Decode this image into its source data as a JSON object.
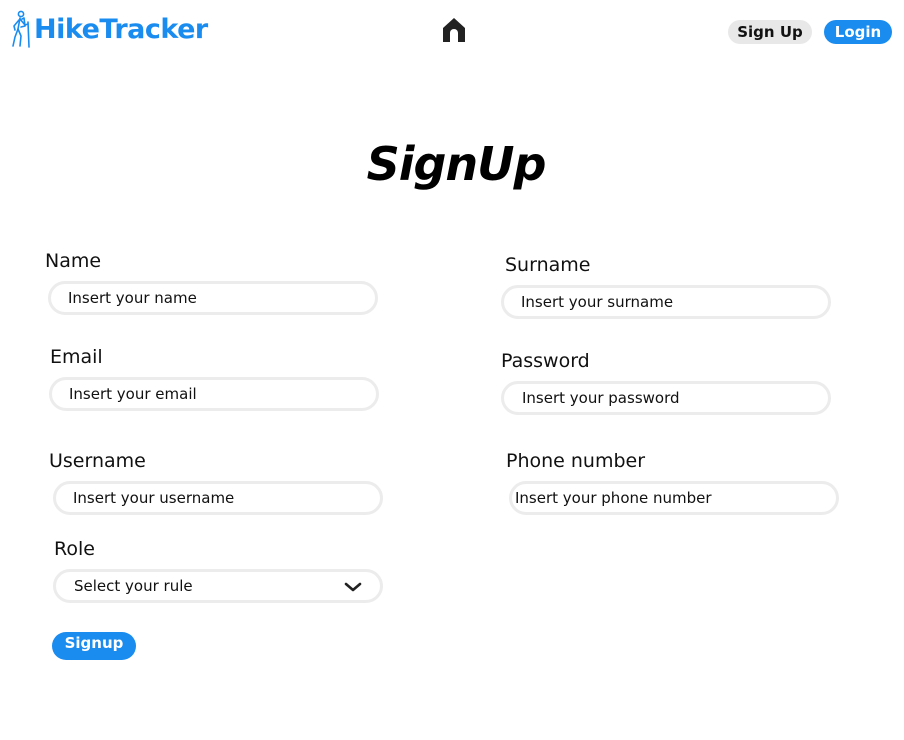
{
  "header": {
    "logo_text": "HikeTracker",
    "brand_color": "#1a8cf0",
    "home_icon": "home-icon",
    "signup_label": "Sign Up",
    "login_label": "Login"
  },
  "main": {
    "title": "SignUp",
    "fields": {
      "name": {
        "label": "Name",
        "placeholder": "Insert your name"
      },
      "surname": {
        "label": "Surname",
        "placeholder": "Insert your surname"
      },
      "email": {
        "label": "Email",
        "placeholder": "Insert your email"
      },
      "password": {
        "label": "Password",
        "placeholder": "Insert your password"
      },
      "username": {
        "label": "Username",
        "placeholder": "Insert your username"
      },
      "phone": {
        "label": "Phone number",
        "placeholder": "Insert your phone number"
      },
      "role": {
        "label": "Role",
        "selected": "Select your rule"
      }
    },
    "submit_label": "Signup"
  }
}
